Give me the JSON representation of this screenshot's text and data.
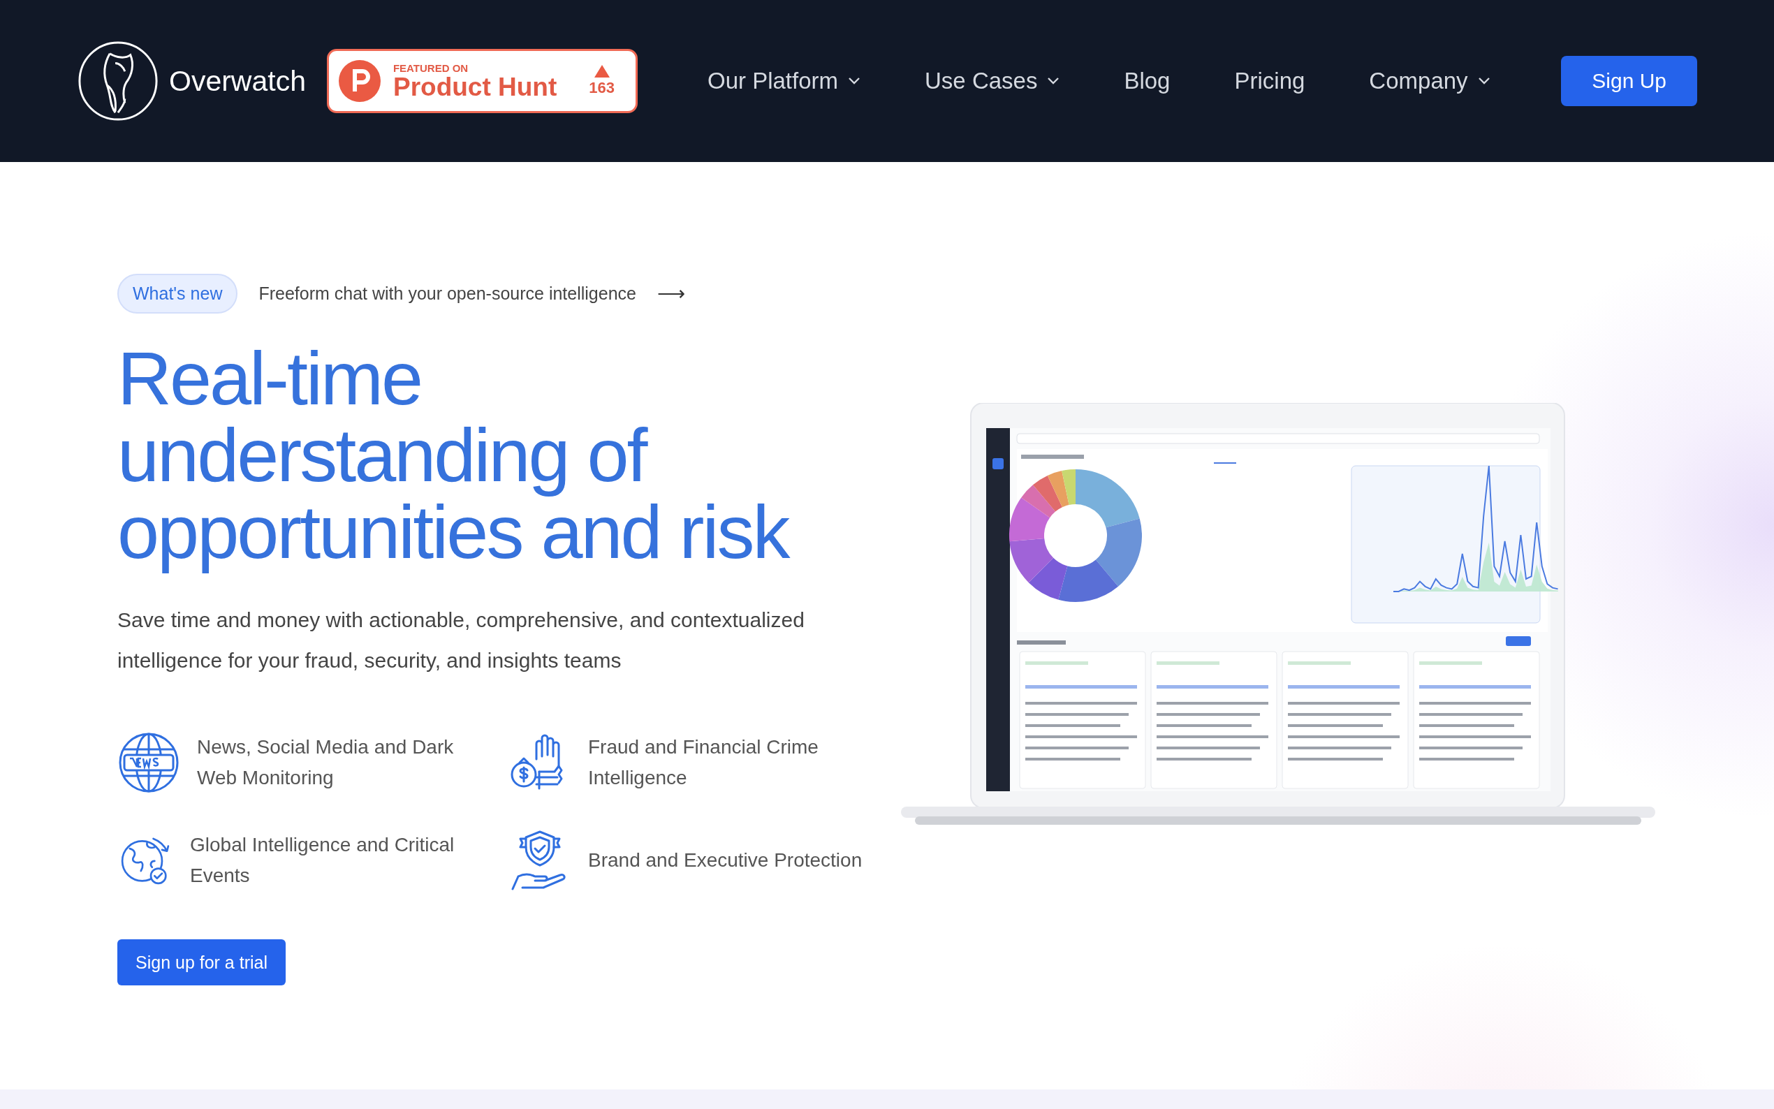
{
  "header": {
    "brand": "Overwatch",
    "product_hunt": {
      "kicker": "FEATURED ON",
      "name": "Product Hunt",
      "votes": "163"
    },
    "nav": [
      {
        "label": "Our Platform",
        "dropdown": true
      },
      {
        "label": "Use Cases",
        "dropdown": true
      },
      {
        "label": "Blog",
        "dropdown": false
      },
      {
        "label": "Pricing",
        "dropdown": false
      },
      {
        "label": "Company",
        "dropdown": true
      }
    ],
    "cta": "Sign Up"
  },
  "hero": {
    "badge": "What's new",
    "announcement": "Freeform chat with your open-source intelligence",
    "arrow": "⟶",
    "title_lines": [
      "Real-time",
      "understanding of",
      "opportunities and risk"
    ],
    "subtitle": "Save time and money with actionable, comprehensive, and contextualized intelligence for your fraud, security, and insights teams",
    "features": [
      {
        "kind": "news",
        "text": "News, Social Media and Dark Web Monitoring"
      },
      {
        "kind": "fraud",
        "text": "Fraud and Financial Crime Intelligence"
      },
      {
        "kind": "globe",
        "text": "Global Intelligence and Critical Events"
      },
      {
        "kind": "protection",
        "text": "Brand and Executive Protection"
      }
    ],
    "cta": "Sign up for a trial"
  }
}
